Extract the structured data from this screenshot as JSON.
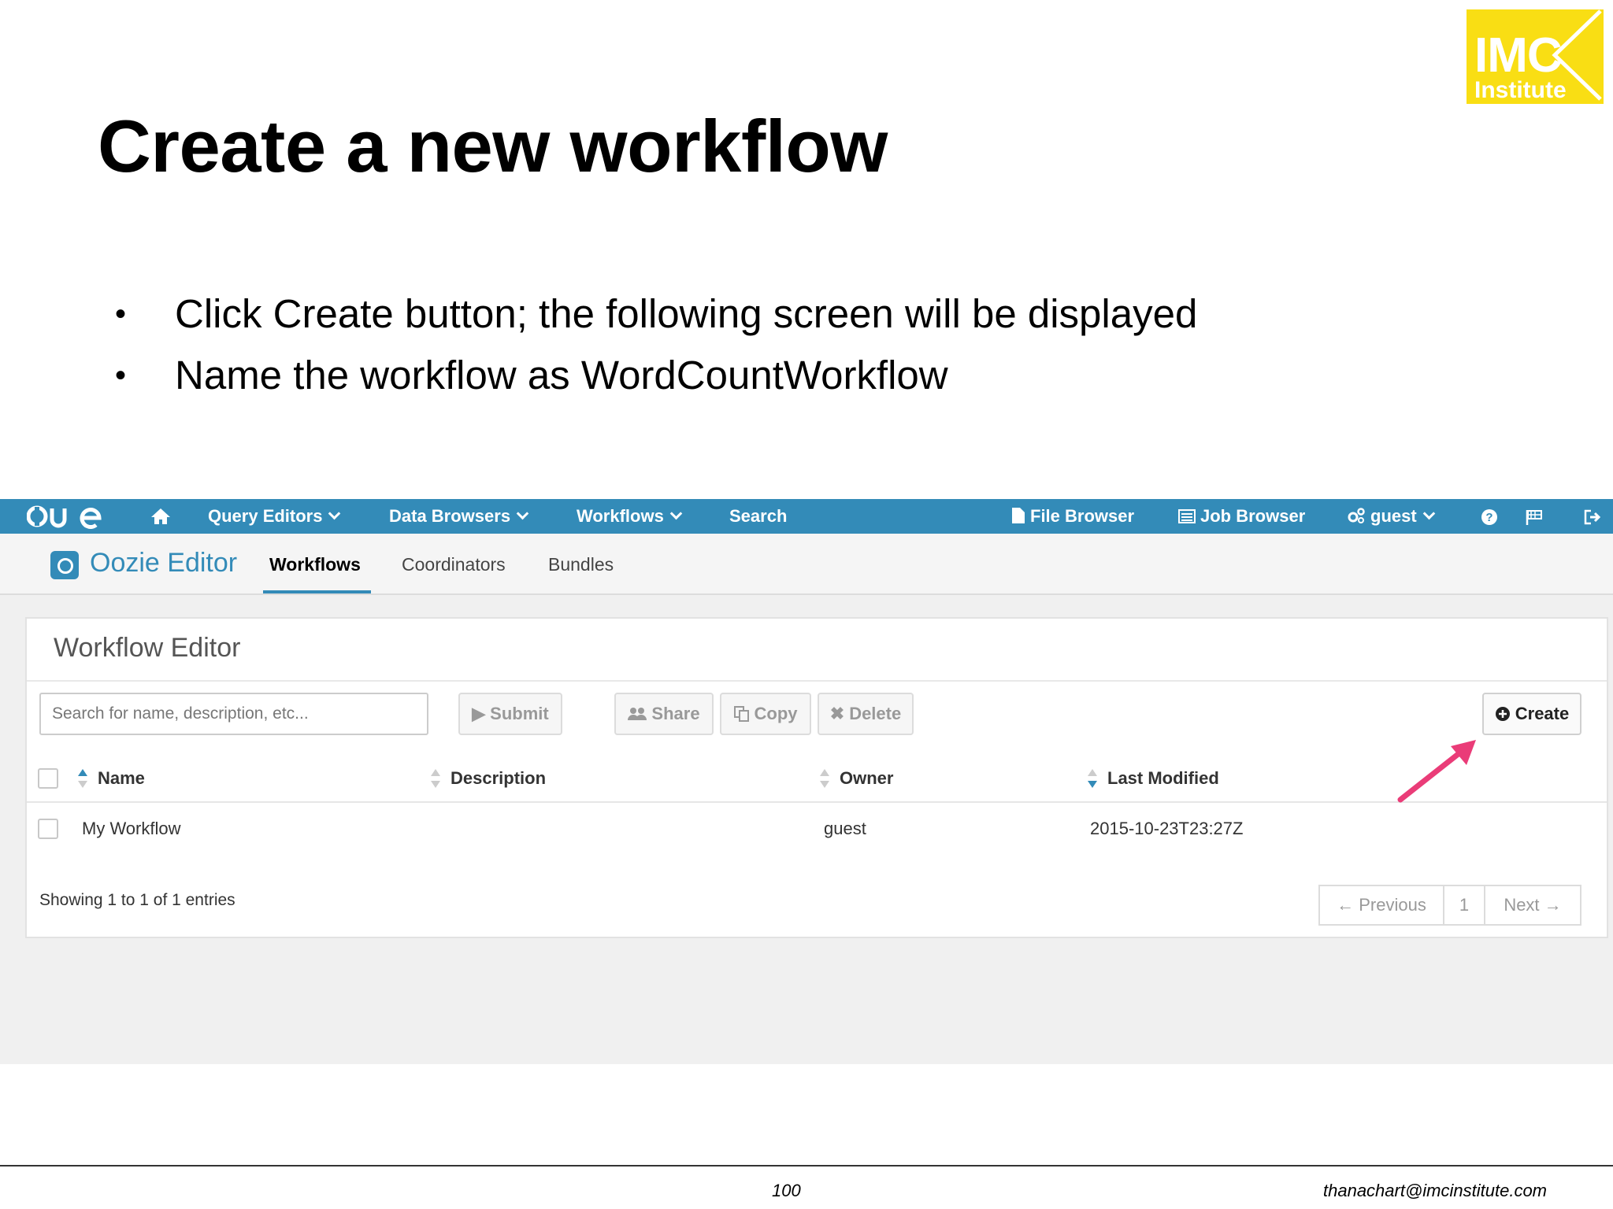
{
  "slide": {
    "title": "Create a new workflow",
    "logo": {
      "line1": "IMC",
      "line2": "Institute"
    },
    "bullets": [
      "Click Create button; the following screen will be displayed",
      "Name the workflow as WordCountWorkflow"
    ],
    "bullet_glyph": "•",
    "footer": {
      "page_number": "100",
      "email": "thanachart@imcinstitute.com"
    }
  },
  "hue": {
    "topnav": {
      "logo_icon": "hue-logo",
      "home_icon": "home-icon",
      "items": [
        {
          "label": "Query Editors"
        },
        {
          "label": "Data Browsers"
        },
        {
          "label": "Workflows"
        },
        {
          "label": "Search"
        },
        {
          "label": "File Browser"
        },
        {
          "label": "Job Browser"
        },
        {
          "label": "guest"
        }
      ],
      "right_icons": [
        "help-icon",
        "flag-icon",
        "logout-icon"
      ]
    },
    "subnav": {
      "app_title": "Oozie Editor",
      "tabs": [
        {
          "label": "Workflows",
          "active": true
        },
        {
          "label": "Coordinators",
          "active": false
        },
        {
          "label": "Bundles",
          "active": false
        }
      ]
    },
    "editor": {
      "title": "Workflow Editor",
      "search_placeholder": "Search for name, description, etc...",
      "buttons": {
        "submit": "Submit",
        "share": "Share",
        "copy": "Copy",
        "delete": "Delete",
        "create": "Create"
      },
      "columns": [
        "Name",
        "Description",
        "Owner",
        "Last Modified"
      ],
      "rows": [
        {
          "name": "My Workflow",
          "description": "",
          "owner": "guest",
          "last_modified": "2015-10-23T23:27Z"
        }
      ],
      "showing": "Showing 1 to 1 of 1 entries",
      "pagination": {
        "previous": "← Previous",
        "page": "1",
        "next": "Next →"
      }
    },
    "colors": {
      "navbar": "#338bb8",
      "arrow": "#ea3c78",
      "logo": "#f9de14"
    }
  }
}
